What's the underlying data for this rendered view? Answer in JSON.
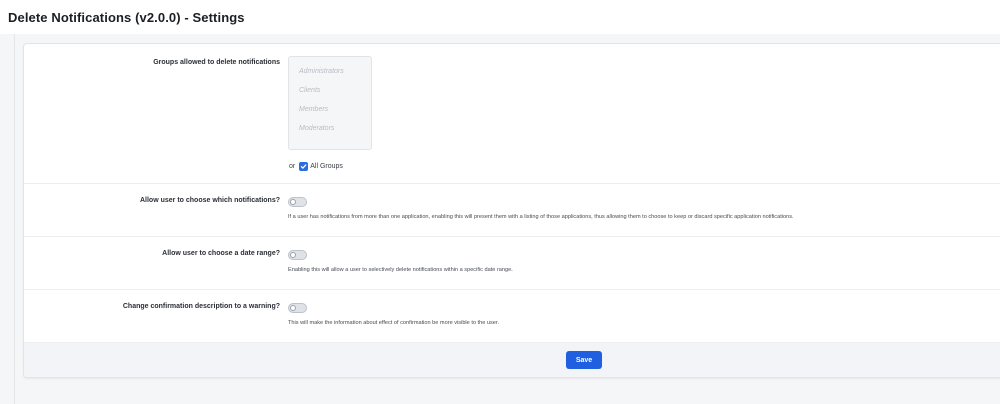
{
  "page": {
    "title": "Delete Notifications (v2.0.0) - Settings"
  },
  "settings": {
    "groups": {
      "label": "Groups allowed to delete notifications",
      "options": [
        "Administrators",
        "Clients",
        "Members",
        "Moderators"
      ],
      "or_text": "or",
      "all_groups_label": "All Groups",
      "all_groups_checked": true
    },
    "choose_notifications": {
      "label": "Allow user to choose which notifications?",
      "enabled": false,
      "description": "If a user has notifications from more than one application, enabling this will present them with a listing of those applications, thus allowing them to choose to keep or discard specific application notifications."
    },
    "date_range": {
      "label": "Allow user to choose a date range?",
      "enabled": false,
      "description": "Enabling this will allow a user to selectively delete notifications within a specific date range."
    },
    "warning": {
      "label": "Change confirmation description to a warning?",
      "enabled": false,
      "description": "This will make the information about effect of confirmation be more visible to the user."
    }
  },
  "footer": {
    "save_label": "Save"
  },
  "colors": {
    "accent": "#1f5fe0",
    "checkbox": "#2a6dde",
    "background": "#f5f6f8"
  }
}
